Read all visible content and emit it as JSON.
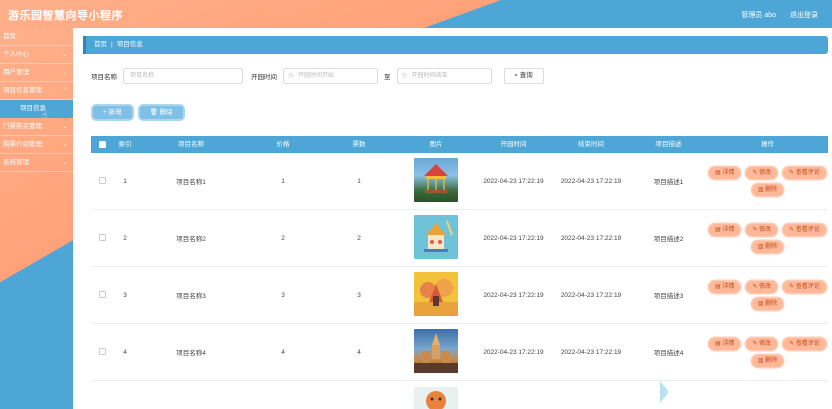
{
  "header": {
    "title": "游乐园智慧向导小程序",
    "user_label": "管理员 abo",
    "logout": "退出登录"
  },
  "sidebar": {
    "items": [
      {
        "label": "首页",
        "chevron": false
      },
      {
        "label": "个人中心",
        "chevron": true
      },
      {
        "label": "用户管理",
        "chevron": true
      },
      {
        "label": "项目信息管理",
        "chevron": true
      },
      {
        "label": "项目信息",
        "chevron": false,
        "sub": true
      },
      {
        "label": "门票购买管理",
        "chevron": true
      },
      {
        "label": "购票介绍管理",
        "chevron": true
      },
      {
        "label": "系统管理",
        "chevron": true
      }
    ]
  },
  "breadcrumb": {
    "home": "首页",
    "separator": "|",
    "current": "项目信息"
  },
  "search": {
    "name_label": "项目名称",
    "name_placeholder": "项目名称",
    "time_label": "开园时间",
    "start_placeholder": "开园时间开始",
    "to_label": "至",
    "end_placeholder": "开园时间结束",
    "query_button": "查询"
  },
  "actions": {
    "add": "+ 新增",
    "delete": "删除"
  },
  "table": {
    "headers": [
      "",
      "索引",
      "项目名称",
      "价格",
      "票数",
      "图片",
      "开园时间",
      "结束时间",
      "项目描述",
      "操作"
    ],
    "rows": [
      {
        "index": "1",
        "name": "项目名称1",
        "price": "1",
        "count": "1",
        "start": "2022-04-23 17:22:19",
        "end": "2022-04-23 17:22:19",
        "status": "项目描述1"
      },
      {
        "index": "2",
        "name": "项目名称2",
        "price": "2",
        "count": "2",
        "start": "2022-04-23 17:22:19",
        "end": "2022-04-23 17:22:19",
        "status": "项目描述2"
      },
      {
        "index": "3",
        "name": "项目名称3",
        "price": "3",
        "count": "3",
        "start": "2022-04-23 17:22:19",
        "end": "2022-04-23 17:22:19",
        "status": "项目描述3"
      },
      {
        "index": "4",
        "name": "项目名称4",
        "price": "4",
        "count": "4",
        "start": "2022-04-23 17:22:19",
        "end": "2022-04-23 17:22:19",
        "status": "项目描述4"
      }
    ],
    "ops": {
      "detail": "详情",
      "edit": "修改",
      "review": "查看评论",
      "remove": "删除"
    }
  },
  "colors": {
    "accent_orange": "#ffa27a",
    "accent_blue": "#4ea6d6",
    "op_button": "#ffb99a"
  }
}
